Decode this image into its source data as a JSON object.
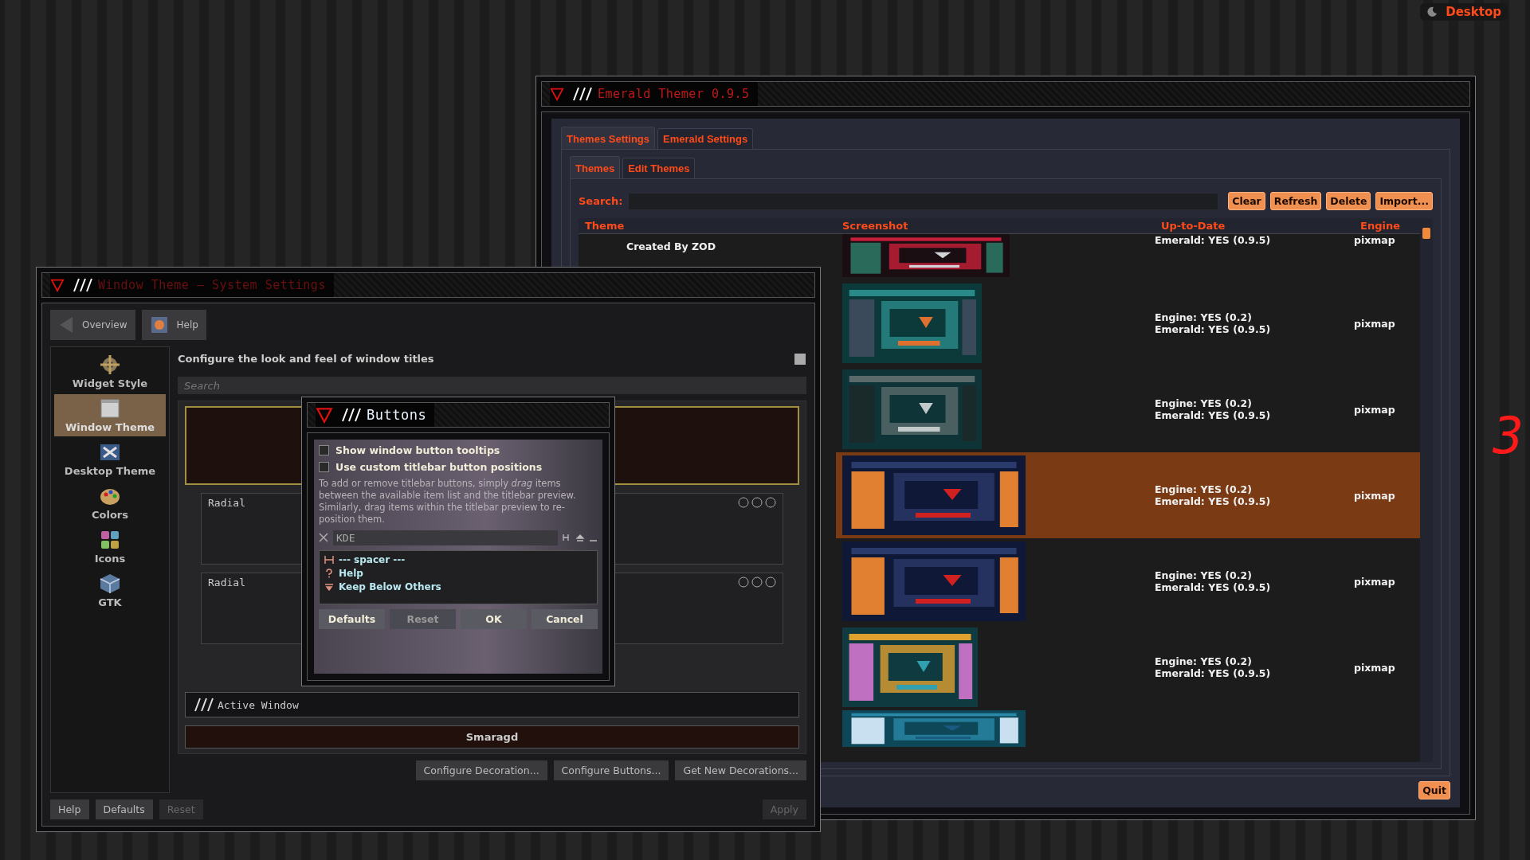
{
  "desktop": {
    "label": "Desktop",
    "workspace": "3"
  },
  "emerald": {
    "title": "Emerald Themer 0.9.5",
    "tabs": [
      {
        "label": "Themes Settings",
        "selected": true
      },
      {
        "label": "Emerald Settings",
        "selected": false
      }
    ],
    "subtabs": [
      {
        "label": "Themes",
        "selected": true
      },
      {
        "label": "Edit Themes",
        "selected": false
      }
    ],
    "search_label": "Search:",
    "buttons": [
      "Clear",
      "Refresh",
      "Delete",
      "Import..."
    ],
    "columns": [
      "Theme",
      "Screenshot",
      "Up-to-Date",
      "Engine"
    ],
    "rows": [
      {
        "theme": [
          "Created By ZOD"
        ],
        "up_to_date": [
          "Emerald: YES (0.9.5)"
        ],
        "engine": "pixmap",
        "selected": false
      },
      {
        "up_to_date": [
          "Engine: YES (0.2)",
          "Emerald: YES (0.9.5)"
        ],
        "engine": "pixmap",
        "selected": false
      },
      {
        "up_to_date": [
          "Engine: YES (0.2)",
          "Emerald: YES (0.9.5)"
        ],
        "engine": "pixmap",
        "selected": false
      },
      {
        "up_to_date": [
          "Engine: YES (0.2)",
          "Emerald: YES (0.9.5)"
        ],
        "engine": "pixmap",
        "selected": true
      },
      {
        "up_to_date": [
          "Engine: YES (0.2)",
          "Emerald: YES (0.9.5)"
        ],
        "engine": "pixmap",
        "selected": false
      },
      {
        "up_to_date": [
          "Engine: YES (0.2)",
          "Emerald: YES (0.9.5)"
        ],
        "engine": "pixmap",
        "selected": false
      },
      {
        "selected": false
      }
    ],
    "quit": "Quit"
  },
  "window_theme": {
    "title": "Window Theme – System Settings",
    "toolbar": [
      {
        "label": "Overview",
        "kind": "back"
      },
      {
        "label": "Help",
        "kind": "help"
      }
    ],
    "sidebar": [
      {
        "label": "Widget Style",
        "kind": "widget",
        "selected": false
      },
      {
        "label": "Window Theme",
        "kind": "window",
        "selected": true
      },
      {
        "label": "Desktop Theme",
        "kind": "desktop",
        "selected": false
      },
      {
        "label": "Colors",
        "kind": "colors",
        "selected": false
      },
      {
        "label": "Icons",
        "kind": "icons",
        "selected": false
      },
      {
        "label": "GTK",
        "kind": "gtk",
        "selected": false
      }
    ],
    "heading": "Configure the look and feel of window titles",
    "search": {
      "placeholder": "Search"
    },
    "preview_windows": [
      "Radial",
      "Radial"
    ],
    "active_bar": "Active Window",
    "decoration": "Smaragd",
    "actions": [
      "Configure Decoration...",
      "Configure Buttons...",
      "Get New Decorations..."
    ],
    "footer": [
      {
        "label": "Help",
        "disabled": false
      },
      {
        "label": "Defaults",
        "disabled": false
      },
      {
        "label": "Reset",
        "disabled": true
      },
      {
        "label": "Apply",
        "disabled": true
      }
    ]
  },
  "dialog": {
    "title": "Buttons",
    "options": [
      {
        "label": "Show window button tooltips",
        "checked": false
      },
      {
        "label": "Use custom titlebar button positions",
        "checked": false
      }
    ],
    "hint": "To add or remove titlebar buttons, simply *drag* items between the available item list and the titlebar preview. Similarly, drag items within the titlebar preview to re-position them.",
    "preview_title": "KDE",
    "items": [
      {
        "label": "--- spacer ---",
        "kind": "spacer"
      },
      {
        "label": "Help",
        "kind": "help"
      },
      {
        "label": "Keep Below Others",
        "kind": "below"
      }
    ],
    "buttons": [
      {
        "label": "Defaults",
        "disabled": false
      },
      {
        "label": "Reset",
        "disabled": true
      },
      {
        "label": "OK",
        "disabled": false
      },
      {
        "label": "Cancel",
        "disabled": false
      }
    ]
  }
}
